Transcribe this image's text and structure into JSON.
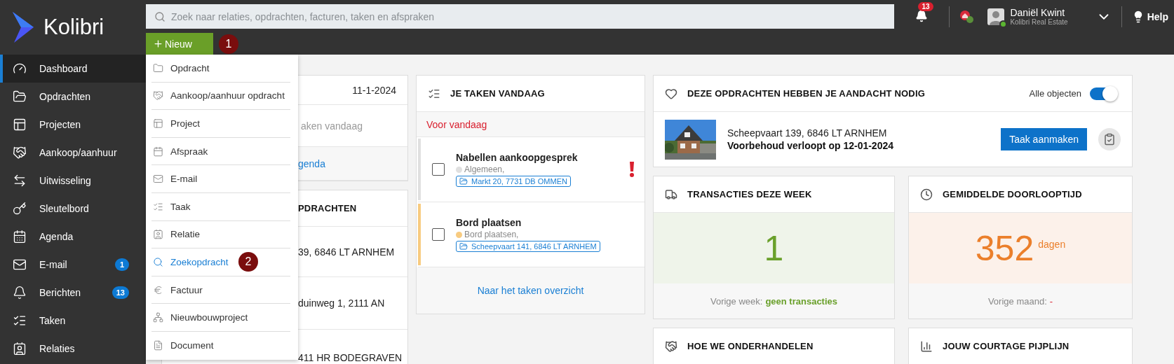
{
  "logo": {
    "name": "Kolibri"
  },
  "search": {
    "placeholder": "Zoek naar relaties, opdrachten, facturen, taken en afspraken"
  },
  "notifications": {
    "count": "13"
  },
  "user": {
    "name": "Daniël Kwint",
    "company": "Kolibri Real Estate",
    "online": true
  },
  "help": "Help",
  "new_button": {
    "label": "Nieuw",
    "marker": "1"
  },
  "new_menu": {
    "items": [
      {
        "label": "Opdracht",
        "selected": false
      },
      {
        "label": "Aankoop/aanhuur opdracht",
        "selected": false
      },
      {
        "label": "Project",
        "selected": false
      },
      {
        "label": "Afspraak",
        "selected": false
      },
      {
        "label": "E-mail",
        "selected": false
      },
      {
        "label": "Taak",
        "selected": false
      },
      {
        "label": "Relatie",
        "selected": false
      },
      {
        "label": "Zoekopdracht",
        "selected": true,
        "marker": "2"
      },
      {
        "label": "Factuur",
        "selected": false
      },
      {
        "label": "Nieuwbouwproject",
        "selected": false
      },
      {
        "label": "Document",
        "selected": false
      }
    ]
  },
  "sidebar": {
    "items": [
      {
        "label": "Dashboard",
        "selected": true
      },
      {
        "label": "Opdrachten",
        "selected": false
      },
      {
        "label": "Projecten",
        "selected": false
      },
      {
        "label": "Aankoop/aanhuur",
        "selected": false
      },
      {
        "label": "Uitwisseling",
        "selected": false
      },
      {
        "label": "Sleutelbord",
        "selected": false
      },
      {
        "label": "Agenda",
        "selected": false
      },
      {
        "label": "E-mail",
        "selected": false,
        "badge": "1"
      },
      {
        "label": "Berichten",
        "selected": false,
        "badge": "13"
      },
      {
        "label": "Taken",
        "selected": false
      },
      {
        "label": "Relaties",
        "selected": false
      }
    ]
  },
  "agenda_card": {
    "date": "11-1-2024",
    "empty_text": "aken vandaag",
    "link": "genda"
  },
  "assignments_card": {
    "title": "PDRACHTEN",
    "rows": [
      "39, 6846 LT ARNHEM",
      "duinweg 1, 2111 AN",
      "411 HR BODEGRAVEN"
    ]
  },
  "tasks_card": {
    "title": "JE TAKEN VANDAAG",
    "section": "Voor vandaag",
    "tasks": [
      {
        "title": "Nabellen aankoopgesprek",
        "category": "Algemeen,",
        "color": "#e0e0e0",
        "address": "Markt 20, 7731 DB OMMEN",
        "checked": false,
        "urgent": true
      },
      {
        "title": "Bord plaatsen",
        "category": "Bord plaatsen,",
        "color": "#f8cb80",
        "address": "Scheepvaart 141, 6846 LT ARNHEM",
        "checked": false,
        "urgent": false
      }
    ],
    "footer_link": "Naar het taken overzicht"
  },
  "attention_card": {
    "title": "DEZE OPDRACHTEN HEBBEN JE AANDACHT NODIG",
    "toggle_label": "Alle objecten",
    "toggle_on": true,
    "items": [
      {
        "kind": "picture",
        "address": "Scheepvaart 139, 6846 LT ARNHEM",
        "notice": "Voorbehoud verloopt op 12-01-2024",
        "button": "Taak aanmaken"
      }
    ]
  },
  "stats": [
    {
      "kind": "positive",
      "title": "TRANSACTIES DEZE WEEK",
      "value": "1",
      "footer_label": "Vorige week:",
      "footer_value": "geen transacties"
    },
    {
      "kind": "warning",
      "title": "GEMIDDELDE DOORLOOPTIJD",
      "value": "352",
      "unit": "dagen",
      "footer_label": "Vorige maand:",
      "footer_value": "-"
    }
  ],
  "more_cards": [
    {
      "title": "HOE WE ONDERHANDELEN"
    },
    {
      "title": "JOUW COURTAGE PIJPLIJN"
    }
  ]
}
